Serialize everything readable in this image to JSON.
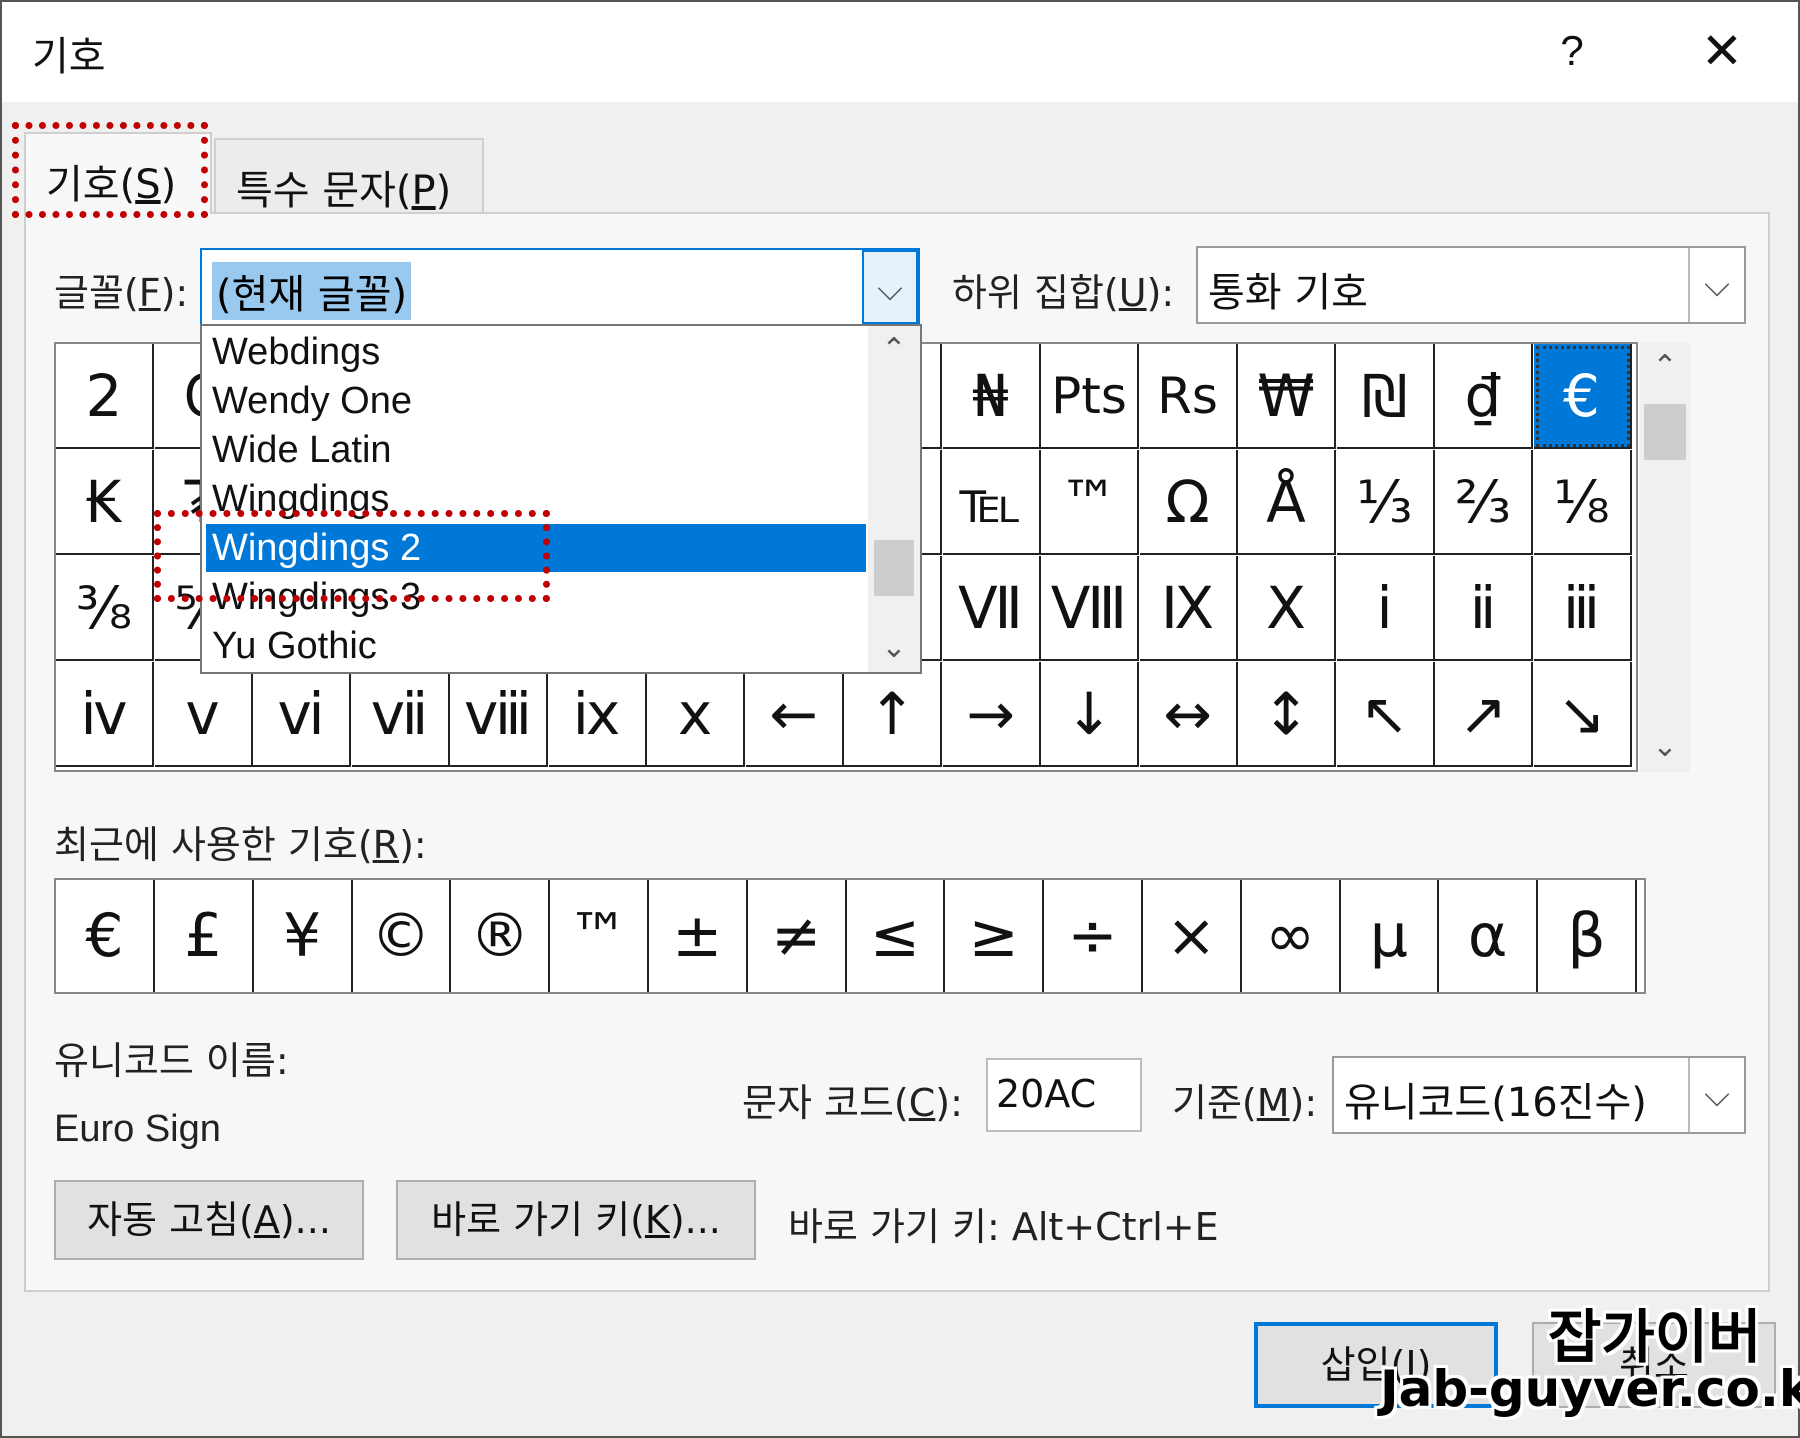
{
  "dialog": {
    "title": "기호",
    "help_label": "?",
    "close_label": "✕"
  },
  "tabs": [
    {
      "label": "기호(",
      "key": "S",
      "close": ")"
    },
    {
      "label": "특수 문자(",
      "key": "P",
      "close": ")"
    }
  ],
  "font_field": {
    "label_prefix": "글꼴(",
    "key": "F",
    "label_suffix": "):",
    "value": "(현재 글꼴)"
  },
  "subset_field": {
    "label_prefix": "하위 집합(",
    "key": "U",
    "label_suffix": "):",
    "value": "통화 기호"
  },
  "font_dropdown": {
    "items": [
      "Webdings",
      "Wendy One",
      "Wide Latin",
      "Wingdings",
      "Wingdings 2",
      "Wingdings 3",
      "Yu Gothic"
    ],
    "selected": "Wingdings 2"
  },
  "symbol_grid": {
    "rows": [
      [
        "2",
        "₢",
        "₣",
        "₤",
        "₥",
        "₦",
        "₧",
        "₨",
        "₩",
        "₪",
        "₫",
        "₰",
        "₦",
        "Pts",
        "Rs",
        "₩",
        "₪",
        "₫",
        "€"
      ],
      [
        "₭",
        "₮",
        "₯",
        "₰",
        "₱",
        "₲",
        "₳",
        "№",
        "℗",
        "℡",
        "™",
        "Ω",
        "Å",
        "⅓",
        "⅔",
        "⅛",
        "℡",
        "™",
        "Ω"
      ],
      [
        "⅜",
        "⅝",
        "⅞",
        "Ⅰ",
        "Ⅱ",
        "Ⅲ",
        "Ⅳ",
        "Ⅴ",
        "Ⅵ",
        "Ⅶ",
        "Ⅷ",
        "Ⅸ",
        "Ⅹ",
        "ⅰ",
        "ⅱ",
        "ⅲ",
        "Ⅷ",
        "Ⅸ",
        "Ⅹ"
      ],
      [
        "ⅳ",
        "ⅴ",
        "ⅵ",
        "ⅶ",
        "ⅷ",
        "ⅸ",
        "ⅹ",
        "←",
        "↑",
        "→",
        "↓",
        "↔",
        "↕",
        "↖",
        "↗",
        "↘",
        "↓",
        "↔",
        "↕"
      ]
    ],
    "visible_rows": [
      [
        "2",
        "₢",
        "₣",
        "₤",
        "₥",
        "₦",
        "₧",
        "₨",
        "₩",
        "₦",
        "Pts",
        "Rs",
        "₩",
        "₪",
        "₫",
        "€"
      ],
      [
        "₭",
        "₮",
        "₯",
        "₰",
        "₱",
        "₲",
        "₳",
        "№",
        "℗",
        "℡",
        "™",
        "Ω",
        "Å",
        "⅓",
        "⅔",
        "⅛"
      ],
      [
        "⅜",
        "⅝",
        "⅞",
        "Ⅰ",
        "Ⅱ",
        "Ⅲ",
        "Ⅳ",
        "Ⅴ",
        "Ⅵ",
        "Ⅶ",
        "Ⅷ",
        "Ⅸ",
        "Ⅹ",
        "ⅰ",
        "ⅱ",
        "ⅲ"
      ],
      [
        "ⅳ",
        "ⅴ",
        "ⅵ",
        "ⅶ",
        "ⅷ",
        "ⅸ",
        "ⅹ",
        "←",
        "↑",
        "→",
        "↓",
        "↔",
        "↕",
        "↖",
        "↗",
        "↘"
      ]
    ],
    "selected": "€"
  },
  "recent": {
    "label_prefix": "최근에 사용한 기호(",
    "key": "R",
    "label_suffix": "):",
    "symbols": [
      "€",
      "£",
      "¥",
      "©",
      "®",
      "™",
      "±",
      "≠",
      "≤",
      "≥",
      "÷",
      "×",
      "∞",
      "µ",
      "α",
      "β"
    ]
  },
  "unicode_name": {
    "label": "유니코드 이름:",
    "value": "Euro Sign"
  },
  "char_code": {
    "label_prefix": "문자 코드(",
    "key": "C",
    "label_suffix": "):",
    "value": "20AC"
  },
  "from_field": {
    "label_prefix": "기준(",
    "key": "M",
    "label_suffix": "):",
    "value": "유니코드(16진수)"
  },
  "buttons": {
    "autocorrect_prefix": "자동 고침(",
    "autocorrect_key": "A",
    "autocorrect_suffix": ")...",
    "shortcut_prefix": "바로 가기 키(",
    "shortcut_key": "K",
    "shortcut_suffix": ")...",
    "shortcut_info": "바로 가기 키: Alt+Ctrl+E",
    "insert_prefix": "삽입(",
    "insert_key": "I",
    "insert_suffix": ")",
    "cancel": "취소"
  },
  "watermark": {
    "korean": "잡가이버",
    "url": "Jab-guyver.co.kr"
  }
}
